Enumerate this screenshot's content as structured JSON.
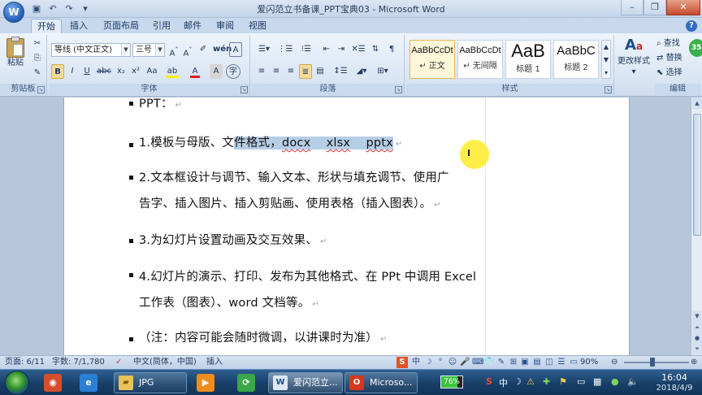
{
  "window": {
    "title": "爱闪范立书备课_PPT宝典03 - Microsoft Word",
    "qat_icons": [
      "save-icon",
      "undo-icon",
      "redo-icon",
      "customize-icon"
    ]
  },
  "tabs": [
    "开始",
    "插入",
    "页面布局",
    "引用",
    "邮件",
    "审阅",
    "视图"
  ],
  "ribbon": {
    "clipboard": {
      "label": "剪贴板",
      "paste": "粘贴"
    },
    "font": {
      "label": "字体",
      "family": "等线 (中文正文)",
      "size": "三号",
      "buttons": [
        "B",
        "I",
        "U",
        "abc",
        "x₂",
        "x²",
        "Aa",
        "A",
        "A",
        "A",
        "A",
        "A"
      ]
    },
    "paragraph": {
      "label": "段落"
    },
    "styles": {
      "label": "样式",
      "items": [
        {
          "sample": "AaBbCcDt",
          "name": "↵ 正文"
        },
        {
          "sample": "AaBbCcDt",
          "name": "↵ 无间隔"
        },
        {
          "sample": "AaB",
          "name": "标题 1"
        },
        {
          "sample": "AaBbC",
          "name": "标题 2"
        }
      ],
      "change": "更改样式"
    },
    "editing": {
      "label": "编辑",
      "find": "查找",
      "replace": "替换",
      "select": "选择"
    }
  },
  "document": {
    "lines": [
      {
        "text": "PPT：",
        "mark": "↵"
      },
      {
        "num": "1.模板与母版、文",
        "sel": "件格式，",
        "ext": [
          "docx",
          "xlsx",
          "pptx"
        ],
        "mark": "↵"
      },
      {
        "text": "2.文本框设计与调节、输入文本、形状与填充调节、使用广"
      },
      {
        "text": "告字、插入图片、插入剪贴画、使用表格（插入图表）。",
        "mark": "↵"
      },
      {
        "text": "3.为幻灯片设置动画及交互效果、",
        "mark": "↵"
      },
      {
        "text": "4.幻灯片的演示、打印、发布为其他格式、在 PPt 中调用 Excel"
      },
      {
        "text": "工作表（图表）、word 文档等。",
        "mark": "↵"
      },
      {
        "text": "（注：内容可能会随时微调，以讲课时为准）",
        "mark": "↵"
      }
    ]
  },
  "status": {
    "page": "页面: 6/11",
    "words": "字数: 7/1,780",
    "language": "中文(简体，中国)",
    "mode": "插入",
    "zoom": "90%",
    "ime_icons": [
      "中",
      "☽",
      "°",
      "☺",
      "🎤",
      "⌨",
      "👕",
      "✎",
      "⊞"
    ]
  },
  "taskbar": {
    "tasks": [
      {
        "label": "JPG"
      },
      {
        "label": "爱闪范立..."
      },
      {
        "label": "Microso..."
      }
    ],
    "battery": "76%",
    "battery_level": 0.76,
    "time": "16:04",
    "date": "2018/4/9"
  },
  "side_badge": "35"
}
